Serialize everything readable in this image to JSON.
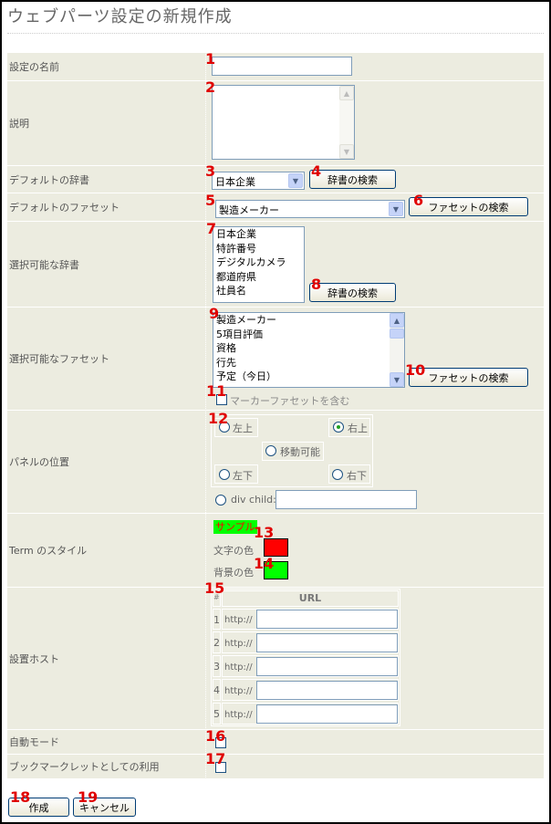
{
  "page": {
    "title": "ウェブパーツ設定の新規作成"
  },
  "fields": {
    "name": {
      "label": "設定の名前",
      "value": ""
    },
    "description": {
      "label": "説明",
      "value": ""
    },
    "default_dictionary": {
      "label": "デフォルトの辞書",
      "selected": "日本企業",
      "search_button": "辞書の検索"
    },
    "default_facet": {
      "label": "デフォルトのファセット",
      "selected": "製造メーカー",
      "search_button": "ファセットの検索"
    },
    "selectable_dictionaries": {
      "label": "選択可能な辞書",
      "options": [
        "日本企業",
        "特許番号",
        "デジタルカメラ",
        "都道府県",
        "社員名"
      ],
      "search_button": "辞書の検索"
    },
    "selectable_facets": {
      "label": "選択可能なファセット",
      "options": [
        "製造メーカー",
        "5項目評価",
        "資格",
        "行先",
        "予定（今日）"
      ],
      "search_button": "ファセットの検索",
      "include_marker_label": "マーカーファセットを含む"
    },
    "panel_position": {
      "label": "パネルの位置",
      "top_left": "左上",
      "top_right": "右上",
      "movable": "移動可能",
      "bottom_left": "左下",
      "bottom_right": "右下",
      "div_child": "div child:",
      "selected": "右上"
    },
    "term_style": {
      "label": "Term のスタイル",
      "sample": "サンプル",
      "text_color_label": "文字の色",
      "bg_color_label": "背景の色",
      "text_color": "#ff0000",
      "bg_color": "#00ff00"
    },
    "install_hosts": {
      "label": "設置ホスト",
      "col_num": "#",
      "col_url": "URL",
      "rows": [
        {
          "num": "1",
          "prefix": "http://",
          "value": ""
        },
        {
          "num": "2",
          "prefix": "http://",
          "value": ""
        },
        {
          "num": "3",
          "prefix": "http://",
          "value": ""
        },
        {
          "num": "4",
          "prefix": "http://",
          "value": ""
        },
        {
          "num": "5",
          "prefix": "http://",
          "value": ""
        }
      ]
    },
    "auto_mode": {
      "label": "自動モード",
      "checked": false
    },
    "bookmarklet": {
      "label": "ブックマークレットとしての利用",
      "checked": false
    }
  },
  "actions": {
    "create": "作成",
    "cancel": "キャンセル"
  },
  "annotations": [
    "1",
    "2",
    "3",
    "4",
    "5",
    "6",
    "7",
    "8",
    "9",
    "10",
    "11",
    "12",
    "13",
    "14",
    "15",
    "16",
    "17",
    "18",
    "19"
  ]
}
